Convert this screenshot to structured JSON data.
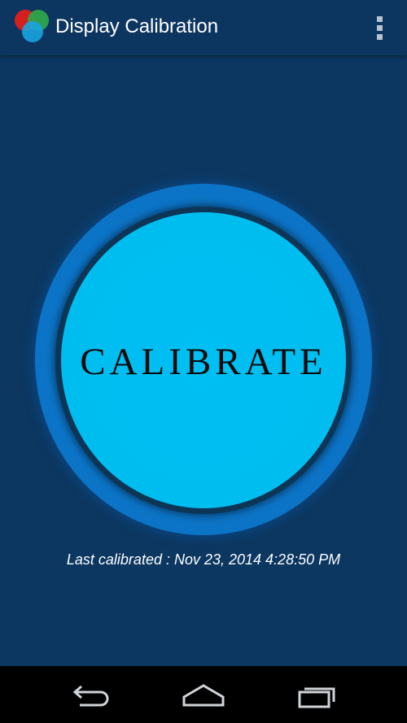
{
  "action_bar": {
    "title": "Display Calibration",
    "app_icon": "rgb-circles-icon",
    "overflow_icon": "overflow-menu-icon"
  },
  "main": {
    "calibrate_label": "CALIBRATE",
    "last_calibrated": "Last calibrated : Nov 23, 2014 4:28:50 PM"
  },
  "nav_bar": {
    "back_icon": "back-icon",
    "home_icon": "home-icon",
    "recent_icon": "recent-apps-icon"
  },
  "colors": {
    "background": "#0c3761",
    "button_fill": "#00bff2",
    "button_halo": "#0c74c6",
    "nav_bar": "#000000"
  }
}
